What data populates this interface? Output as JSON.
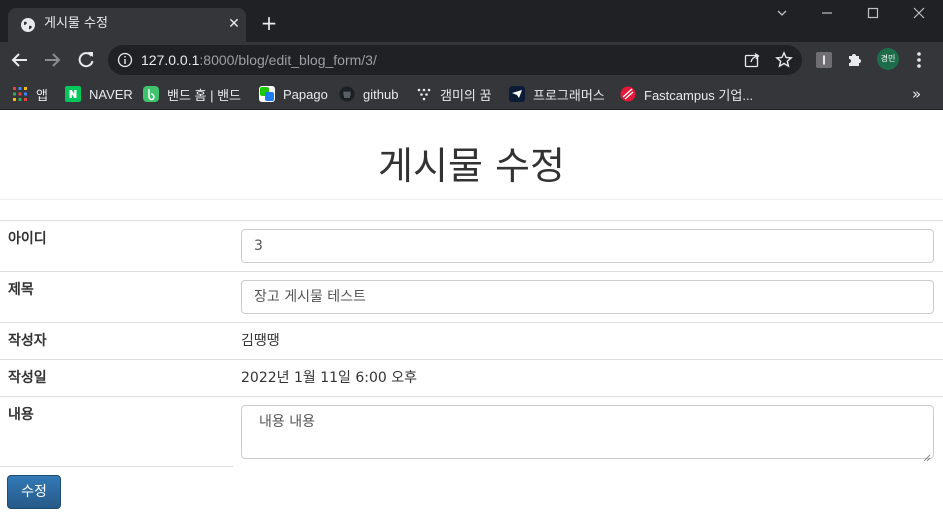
{
  "browser": {
    "tab_title": "게시물 수정",
    "url_host": "127.0.0.1",
    "url_rest": ":8000/blog/edit_blog_form/3/",
    "profile_label": "경민",
    "bookmarks": [
      {
        "label": "앱",
        "icon": "apps-grid-icon"
      },
      {
        "label": "NAVER",
        "icon": "naver-icon"
      },
      {
        "label": "밴드 홈 | 밴드",
        "icon": "band-icon"
      },
      {
        "label": "Papago",
        "icon": "papago-icon"
      },
      {
        "label": "github",
        "icon": "github-icon"
      },
      {
        "label": "갬미의 꿈",
        "icon": "dots-icon"
      },
      {
        "label": "프로그래머스",
        "icon": "programmers-icon"
      },
      {
        "label": "Fastcampus 기업...",
        "icon": "fastcampus-icon"
      }
    ],
    "bookmarks_more": "»"
  },
  "page": {
    "title": "게시물 수정",
    "fields": {
      "id": {
        "label": "아이디",
        "value": "3"
      },
      "title": {
        "label": "제목",
        "value": "장고 게시물 테스트"
      },
      "author": {
        "label": "작성자",
        "value": "김땡땡"
      },
      "created": {
        "label": "작성일",
        "value": "2022년 1월 11일 6:00 오후"
      },
      "content": {
        "label": "내용",
        "value": "내용 내용"
      }
    },
    "submit_label": "수정"
  },
  "colors": {
    "chrome_dark": "#202124",
    "chrome_toolbar": "#35363a",
    "button_primary": "#337ab7",
    "text": "#333333"
  }
}
